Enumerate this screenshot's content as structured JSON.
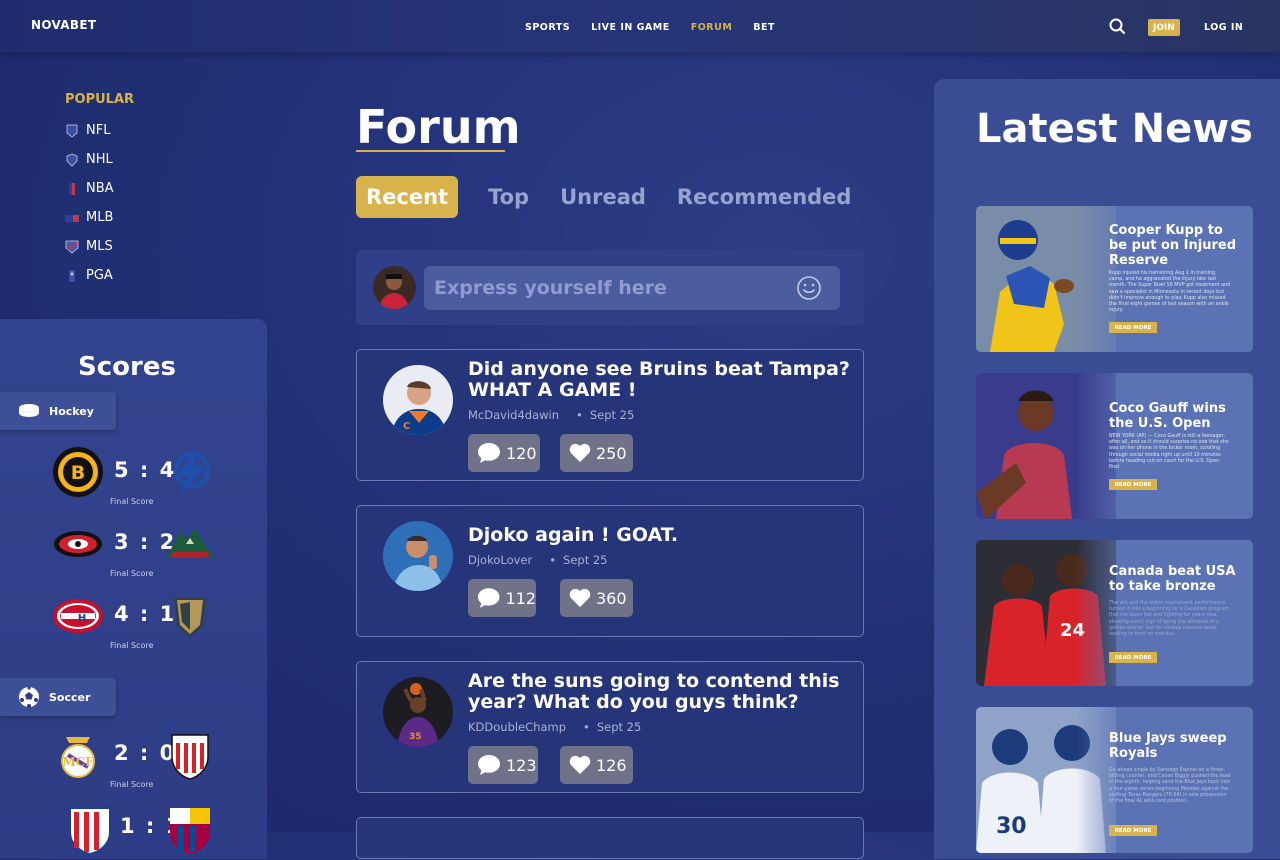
{
  "nav": {
    "logo": "NOVABET",
    "links": [
      "SPORTS",
      "LIVE IN GAME",
      "FORUM",
      "BET"
    ],
    "active_link": "FORUM",
    "join": "JOIN",
    "login": "LOG IN"
  },
  "popular": {
    "title": "POPULAR",
    "items": [
      "NFL",
      "NHL",
      "NBA",
      "MLB",
      "MLS",
      "PGA"
    ]
  },
  "scores": {
    "title": "Scores",
    "sections": [
      {
        "sport": "Hockey",
        "matches": [
          {
            "score": "5 : 4",
            "status": "Final Score",
            "home_icon": "bruins-logo",
            "away_icon": "lightning-logo"
          },
          {
            "score": "3 : 2",
            "status": "Final Score",
            "home_icon": "hurricanes-logo",
            "away_icon": "wild-logo"
          },
          {
            "score": "4 : 1",
            "status": "Final Score",
            "home_icon": "canadiens-logo",
            "away_icon": "golden-knights-logo"
          }
        ]
      },
      {
        "sport": "Soccer",
        "matches": [
          {
            "score": "2 : 0",
            "status": "Final Score",
            "home_icon": "real-madrid-logo",
            "away_icon": "athletic-club-logo"
          },
          {
            "score": "1 : 1",
            "status": "",
            "home_icon": "atletico-logo",
            "away_icon": "barcelona-logo"
          }
        ]
      }
    ]
  },
  "forum": {
    "title": "Forum",
    "tabs": [
      "Recent",
      "Top",
      "Unread",
      "Recommended"
    ],
    "active_tab": "Recent",
    "composer_placeholder": "Express yourself here",
    "posts": [
      {
        "title": "Did anyone see Bruins beat Tampa? WHAT A GAME !",
        "author": "McDavid4dawin",
        "date": "Sept 25",
        "comments": "120",
        "likes": "250"
      },
      {
        "title": "Djoko again ! GOAT.",
        "author": "DjokoLover",
        "date": "Sept 25",
        "comments": "112",
        "likes": "360"
      },
      {
        "title": "Are the suns going to contend this year? What do you guys think?",
        "author": "KDDoubleChamp",
        "date": "Sept 25",
        "comments": "123",
        "likes": "126"
      }
    ]
  },
  "news": {
    "title": "Latest News",
    "cards": [
      {
        "title": "Cooper Kupp to be put on Injured Reserve",
        "text": "Kupp injured his hamstring Aug 1 in training camp, and he aggravated the injury late last month. The Super Bowl 56 MVP got treatment and saw a specialist in Minnesota in recent days but didn't improve enough to play. Kupp also missed the final eight games of last season with an ankle injury.",
        "button": "READ MORE"
      },
      {
        "title": "Coco Gauff wins the U.S. Open",
        "text": "NEW YORK (AP) — Coco Gauff is still a teenager, after all, and so it should surprise no one that she was on her phone in the locker room, scrolling through social media right up until 10 minutes before heading out on court for the U.S. Open final.",
        "button": "READ MORE"
      },
      {
        "title": "Canada beat USA to take bronze",
        "text": "The win and the entire tournament performance turned it into a beginning for a Canadian program that has been flat and fighting for years now, showing every sign of being the attribute of a golden winner, but for various reasons never leading to front on rise day.",
        "button": "READ MORE"
      },
      {
        "title": "Blue Jays sweep Royals",
        "text": "Go-ahead single by Santiago Espinal on a three-hitting counter, and Cavan Biggio pushed the lead in the eighth, helping send the Blue Jays back into a four-game series beginning Monday against the visiting Texas Rangers (78-64) in sole possession of the final AL wild-card position.",
        "button": "READ MORE"
      }
    ]
  }
}
